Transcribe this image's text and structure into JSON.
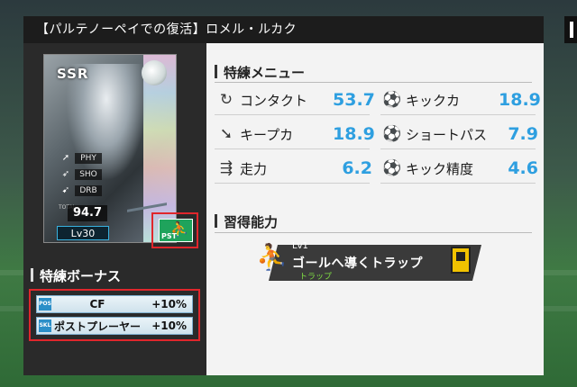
{
  "title": "【パルテノーペイでの復活】ロメル・ルカク",
  "card": {
    "rarity": "SSR",
    "stats": [
      {
        "icon": "kick-icon",
        "label": "PHY"
      },
      {
        "icon": "shot-icon",
        "label": "SHO"
      },
      {
        "icon": "dribble-icon",
        "label": "DRB"
      }
    ],
    "total_label": "TOTAL",
    "total": "94.7",
    "level": "Lv30",
    "position": "PST"
  },
  "bonus": {
    "heading": "特練ボーナス",
    "items": [
      {
        "tag": "POS",
        "name": "CF",
        "value": "+10%"
      },
      {
        "tag": "SKL",
        "name": "ポストプレーヤー",
        "value": "+10%"
      }
    ]
  },
  "training": {
    "heading": "特練メニュー",
    "items": [
      {
        "icon": "contact-icon",
        "name": "コンタクト",
        "value": "53.7"
      },
      {
        "icon": "kick-power-icon",
        "name": "キックカ",
        "value": "18.9"
      },
      {
        "icon": "keeper-icon",
        "name": "キープカ",
        "value": "18.9"
      },
      {
        "icon": "short-pass-icon",
        "name": "ショートパス",
        "value": "7.9"
      },
      {
        "icon": "run-icon",
        "name": "走力",
        "value": "6.2"
      },
      {
        "icon": "kick-accuracy-icon",
        "name": "キック精度",
        "value": "4.6"
      }
    ]
  },
  "ability": {
    "heading": "習得能力",
    "skill": {
      "level": "Lv1",
      "name": "ゴールへ導くトラップ",
      "category": "トラップ"
    }
  }
}
